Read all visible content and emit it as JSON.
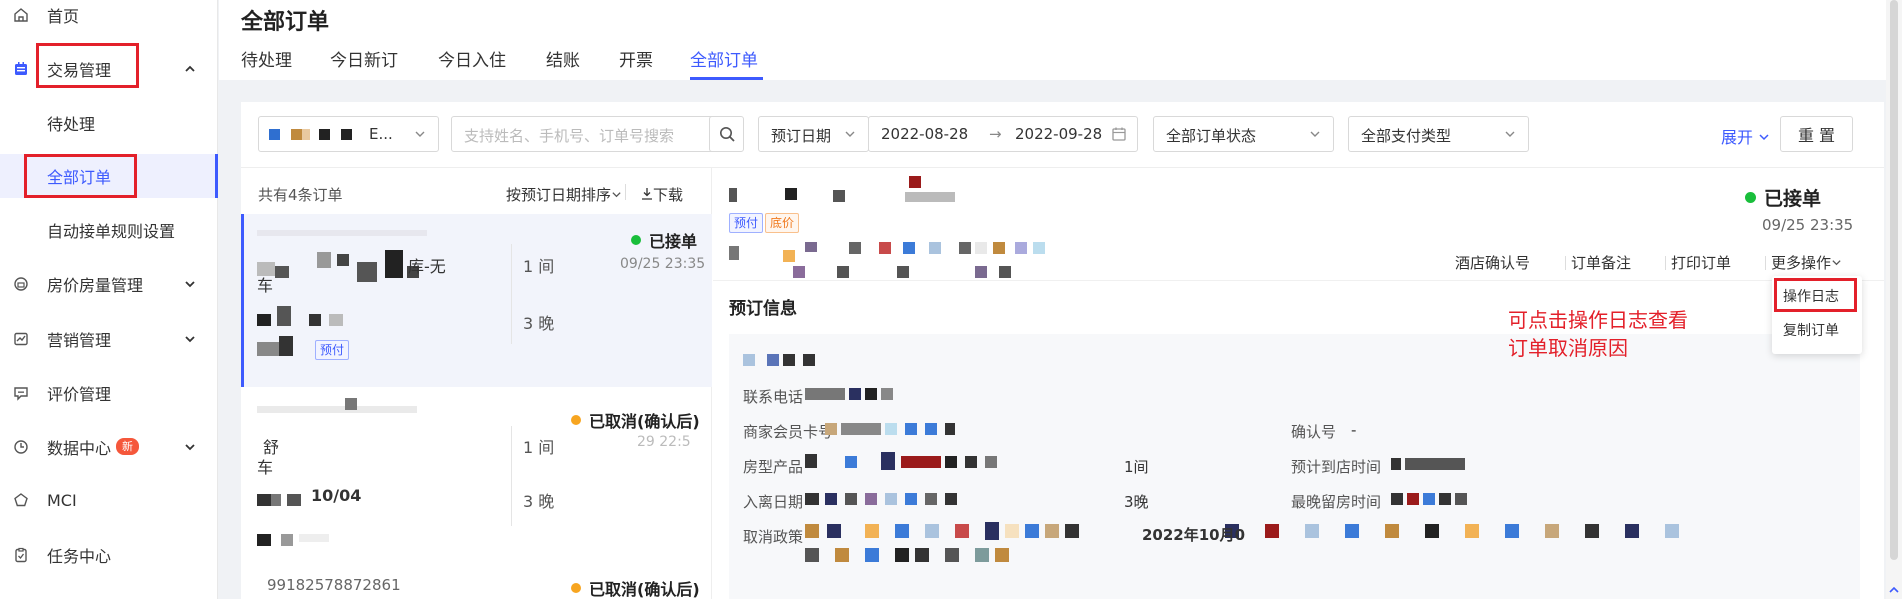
{
  "sidebar": {
    "items": [
      {
        "label": "首页",
        "icon": "home-icon"
      },
      {
        "label": "交易管理",
        "icon": "calendar-icon"
      },
      {
        "label": "房价房量管理",
        "icon": "bed-icon"
      },
      {
        "label": "营销管理",
        "icon": "chart-icon"
      },
      {
        "label": "评价管理",
        "icon": "comment-icon"
      },
      {
        "label": "数据中心",
        "icon": "clock-icon",
        "badge": "新"
      },
      {
        "label": "MCI",
        "icon": "pentagon-icon"
      },
      {
        "label": "任务中心",
        "icon": "clipboard-icon"
      }
    ],
    "sub_items": [
      "待处理",
      "全部订单",
      "自动接单规则设置"
    ]
  },
  "header": {
    "title": "全部订单",
    "tabs": [
      "待处理",
      "今日新订",
      "今日入住",
      "结账",
      "开票",
      "全部订单"
    ]
  },
  "filters": {
    "hotel_suffix": "E...",
    "search_placeholder": "支持姓名、手机号、订单号搜索",
    "date_type": "预订日期",
    "date_start": "2022-08-28",
    "date_arrow": "→",
    "date_end": "2022-09-28",
    "order_status": "全部订单状态",
    "pay_type": "全部支付类型",
    "expand": "展开",
    "reset": "重 置"
  },
  "list": {
    "count": "共有4条订单",
    "sort": "按预订日期排序",
    "download": "下载",
    "orders": [
      {
        "status": "已接单",
        "time": "09/25 23:35",
        "room_text": "库-无",
        "rooms": "1 间",
        "nights": "3 晚",
        "tag": "预付"
      },
      {
        "status": "已取消(确认后)",
        "time": "29 22:5",
        "room_text": "舒",
        "rooms": "1 间",
        "nights": "3 晚",
        "date": "10/04"
      },
      {
        "status": "已取消(确认后)",
        "order_no": "99182578872861"
      }
    ]
  },
  "detail": {
    "status": "已接单",
    "time": "09/25 23:35",
    "tags": [
      "预付",
      "底价"
    ],
    "actions": [
      "酒店确认号",
      "订单备注",
      "打印订单",
      "更多操作"
    ],
    "menu": [
      "操作日志",
      "复制订单"
    ],
    "section_title": "预订信息",
    "labels": {
      "phone": "联系电话",
      "member": "商家会员卡号",
      "room": "房型产品",
      "dates": "入离日期",
      "cancel": "取消政策",
      "confirm_no": "确认号",
      "arrival": "预计到店时间",
      "latest": "最晚留房时间"
    },
    "values": {
      "rooms": "1间",
      "nights": "3晚",
      "confirm_no": "-",
      "cancel_date": "2022年10月0"
    }
  },
  "annotation": {
    "line1": "可点击操作日志查看",
    "line2": "订单取消原因"
  },
  "colors": {
    "accent": "#3d5afe",
    "highlight": "#e3202a",
    "success": "#19be3b",
    "warning": "#f7a520"
  }
}
